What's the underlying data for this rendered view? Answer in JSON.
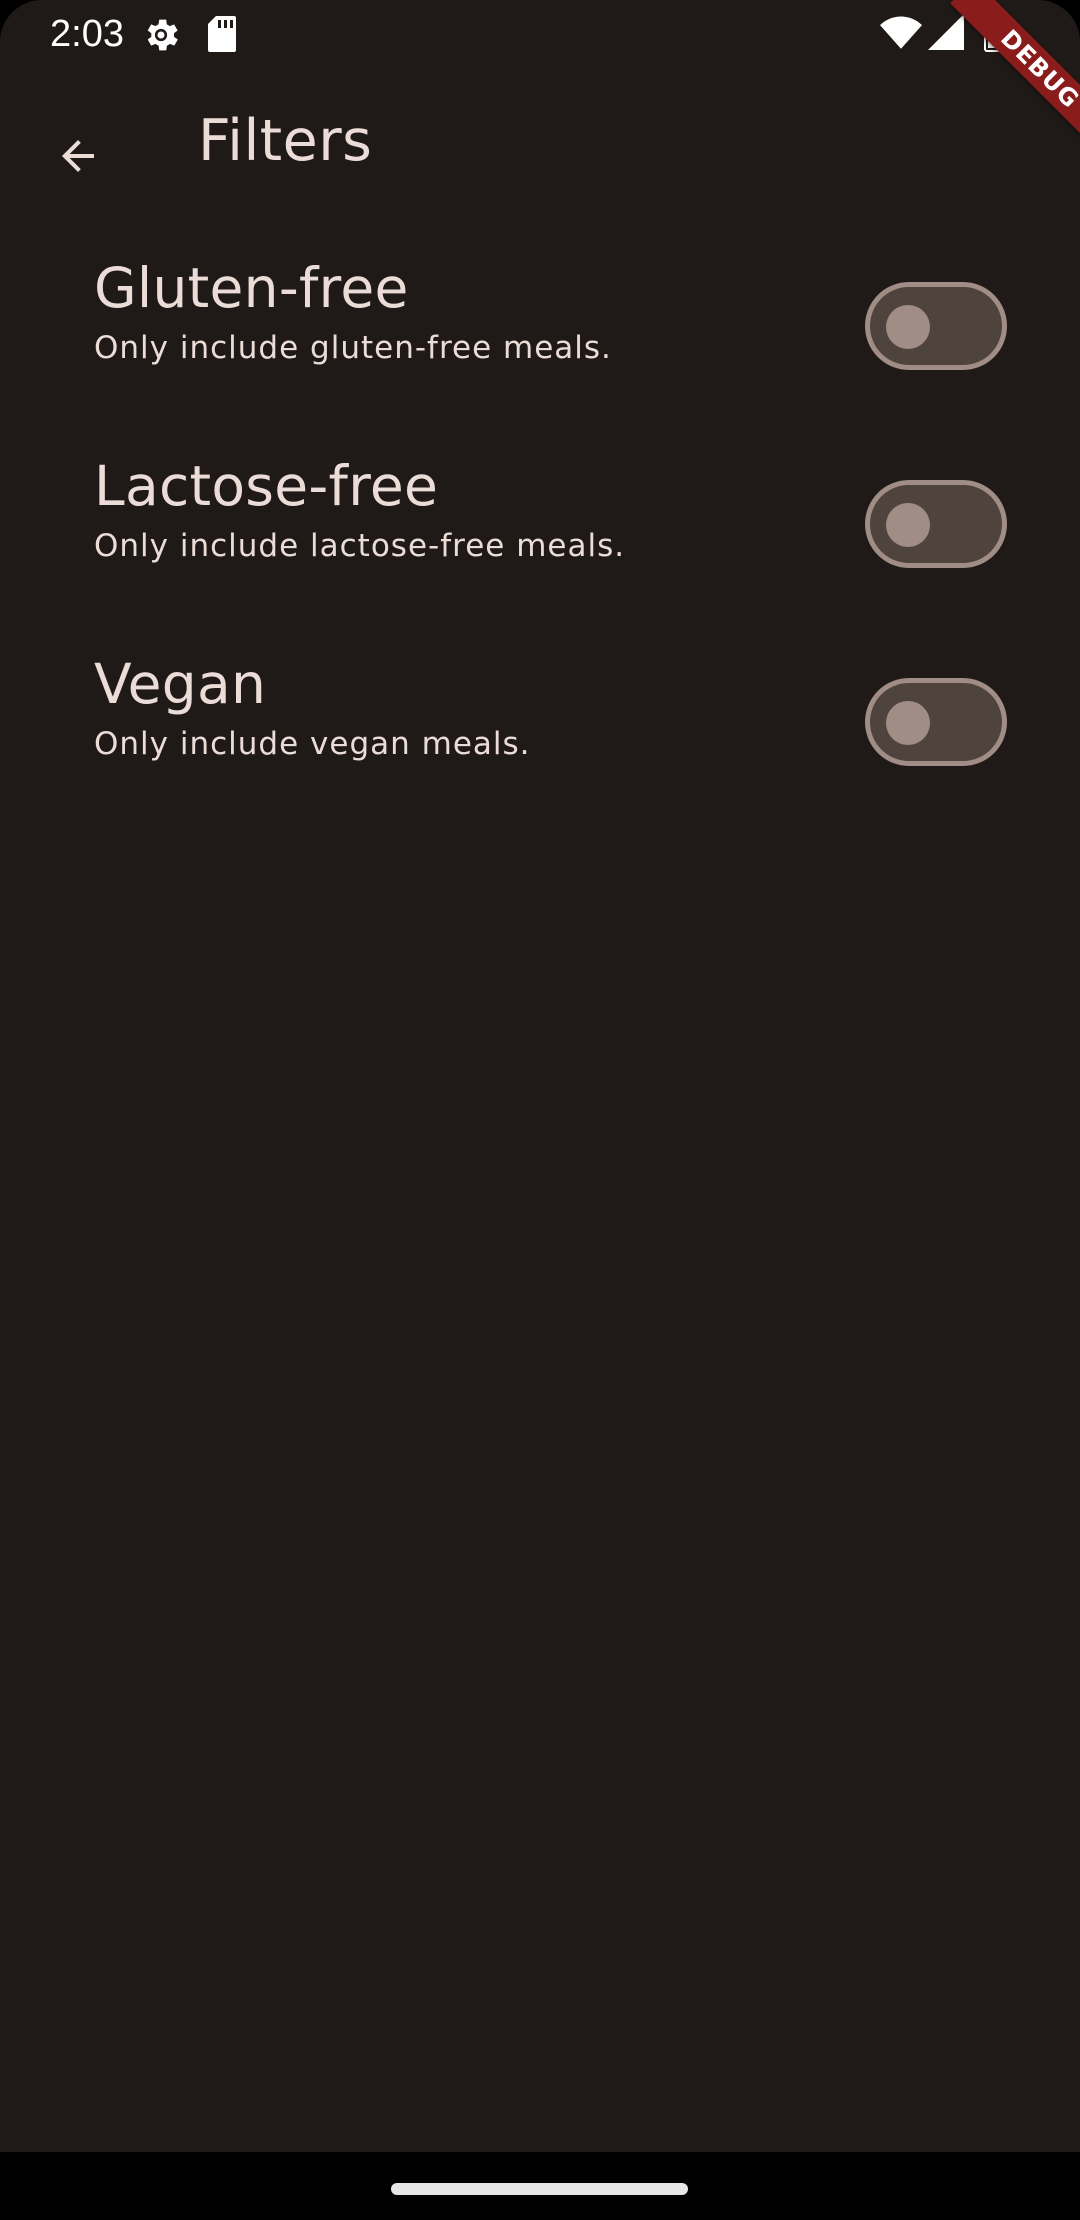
{
  "status_bar": {
    "time": "2:03",
    "icons": [
      "settings-gear-icon",
      "sd-card-icon",
      "wifi-icon",
      "cell-signal-icon",
      "battery-icon"
    ]
  },
  "debug_banner": {
    "label": "DEBUG",
    "color": "#8a1c1c"
  },
  "app_bar": {
    "back_icon": "arrow-back-icon",
    "title": "Filters"
  },
  "filters": [
    {
      "title": "Gluten-free",
      "subtitle": "Only include gluten-free meals.",
      "enabled": false
    },
    {
      "title": "Lactose-free",
      "subtitle": "Only include lactose-free meals.",
      "enabled": false
    },
    {
      "title": "Vegan",
      "subtitle": "Only include vegan meals.",
      "enabled": false
    }
  ],
  "theme": {
    "background": "#1f1a17",
    "text": "#ecdcd7",
    "switch_track": "#4f433d",
    "switch_outline": "#a08d85"
  }
}
